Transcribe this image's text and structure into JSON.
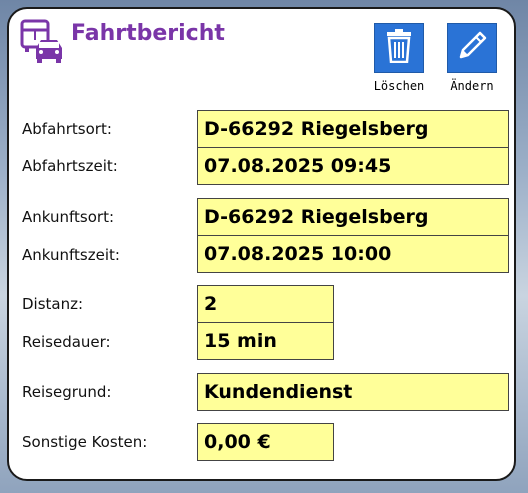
{
  "header": {
    "title": "Fahrtbericht",
    "icon": "bus-car-icon"
  },
  "actions": {
    "delete_label": "Löschen",
    "edit_label": "Ändern",
    "delete_icon": "trash-icon",
    "edit_icon": "pencil-icon"
  },
  "colors": {
    "title": "#7a35a8",
    "accent": "#2a73d6",
    "field_bg": "#ffff99"
  },
  "fields": {
    "abfahrtsort": {
      "label": "Abfahrtsort:",
      "value": "D-66292 Riegelsberg"
    },
    "abfahrtszeit": {
      "label": "Abfahrtszeit:",
      "value": "07.08.2025 09:45"
    },
    "ankunftsort": {
      "label": "Ankunftsort:",
      "value": "D-66292 Riegelsberg"
    },
    "ankunftszeit": {
      "label": "Ankunftszeit:",
      "value": "07.08.2025 10:00"
    },
    "distanz": {
      "label": "Distanz:",
      "value": "2"
    },
    "reisedauer": {
      "label": "Reisedauer:",
      "value": "15 min"
    },
    "reisegrund": {
      "label": "Reisegrund:",
      "value": "Kundendienst"
    },
    "kosten": {
      "label": "Sonstige Kosten:",
      "value": "0,00 €"
    }
  }
}
